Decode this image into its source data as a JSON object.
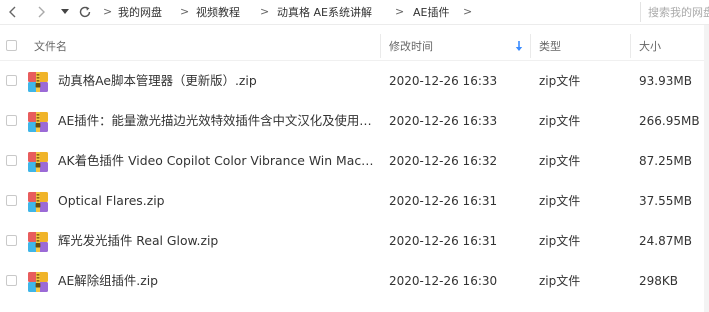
{
  "breadcrumb": {
    "items": [
      "我的网盘",
      "视频教程",
      "动真格 AE系统讲解",
      "AE插件"
    ],
    "separator": ">"
  },
  "search": {
    "placeholder": "搜索我的网盘"
  },
  "table": {
    "columns": {
      "name": "文件名",
      "modified": "修改时间",
      "type": "类型",
      "size": "大小"
    },
    "sort_icon": "sort-down-arrow-icon",
    "rows": [
      {
        "name": "动真格Ae脚本管理器（更新版）.zip",
        "modified": "2020-12-26 16:33",
        "type": "zip文件",
        "size": "93.93MB"
      },
      {
        "name": "AE插件：能量激光描边光效特效插件含中文汉化及使用教程.zip",
        "modified": "2020-12-26 16:33",
        "type": "zip文件",
        "size": "266.95MB"
      },
      {
        "name": "AK着色插件 Video Copilot Color Vibrance Win Mac.zip",
        "modified": "2020-12-26 16:32",
        "type": "zip文件",
        "size": "87.25MB"
      },
      {
        "name": "Optical Flares.zip",
        "modified": "2020-12-26 16:31",
        "type": "zip文件",
        "size": "37.55MB"
      },
      {
        "name": "辉光发光插件 Real Glow.zip",
        "modified": "2020-12-26 16:31",
        "type": "zip文件",
        "size": "24.87MB"
      },
      {
        "name": "AE解除组插件.zip",
        "modified": "2020-12-26 16:30",
        "type": "zip文件",
        "size": "298KB"
      }
    ]
  },
  "colors": {
    "accent": "#3b8cff",
    "zip_icon": [
      "#e85d5d",
      "#f0b429",
      "#3fb6e8",
      "#9b6ad6"
    ]
  }
}
